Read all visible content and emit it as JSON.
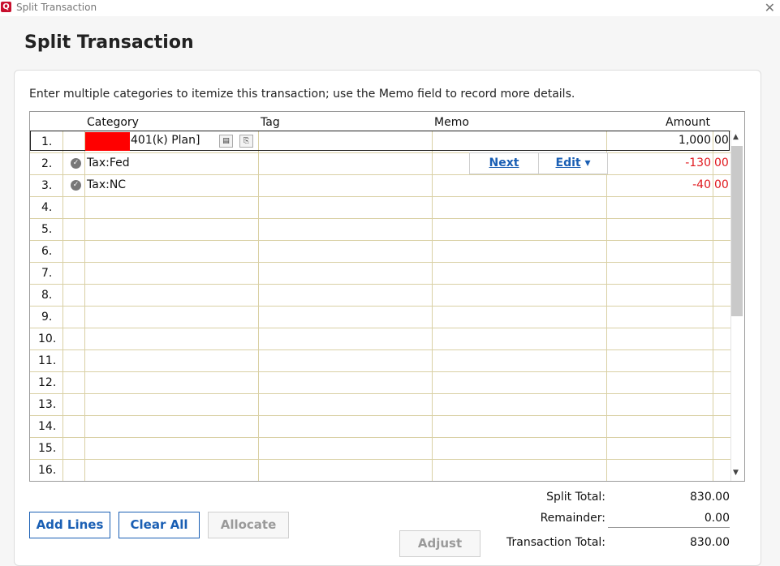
{
  "window": {
    "title": "Split Transaction",
    "logo_letter": "Q"
  },
  "dialog": {
    "title": "Split Transaction",
    "instructions": "Enter multiple categories to itemize this transaction; use the Memo field to record more details."
  },
  "grid": {
    "columns": {
      "category": "Category",
      "tag": "Tag",
      "memo": "Memo",
      "amount": "Amount"
    },
    "rows": [
      {
        "num": "1.",
        "category": "401(k) Plan]",
        "amount": "1,000",
        "cents": "00",
        "negative": false
      },
      {
        "num": "2.",
        "category": "Tax:Fed",
        "amount": "-130",
        "cents": "00",
        "negative": true
      },
      {
        "num": "3.",
        "category": "Tax:NC",
        "amount": "-40",
        "cents": "00",
        "negative": true
      },
      {
        "num": "4."
      },
      {
        "num": "5."
      },
      {
        "num": "6."
      },
      {
        "num": "7."
      },
      {
        "num": "8."
      },
      {
        "num": "9."
      },
      {
        "num": "10."
      },
      {
        "num": "11."
      },
      {
        "num": "12."
      },
      {
        "num": "13."
      },
      {
        "num": "14."
      },
      {
        "num": "15."
      },
      {
        "num": "16."
      }
    ],
    "row_buttons": {
      "next": "Next",
      "edit": "Edit"
    }
  },
  "buttons": {
    "add_lines": "Add Lines",
    "clear_all": "Clear All",
    "allocate": "Allocate",
    "adjust": "Adjust"
  },
  "totals": {
    "split_total_label": "Split Total:",
    "split_total": "830.00",
    "remainder_label": "Remainder:",
    "remainder": "0.00",
    "transaction_total_label": "Transaction Total:",
    "transaction_total": "830.00"
  },
  "colors": {
    "accent": "#1a5fb4",
    "negative": "#e0191e",
    "brand": "#c8102e",
    "redaction": "#ff0000"
  }
}
